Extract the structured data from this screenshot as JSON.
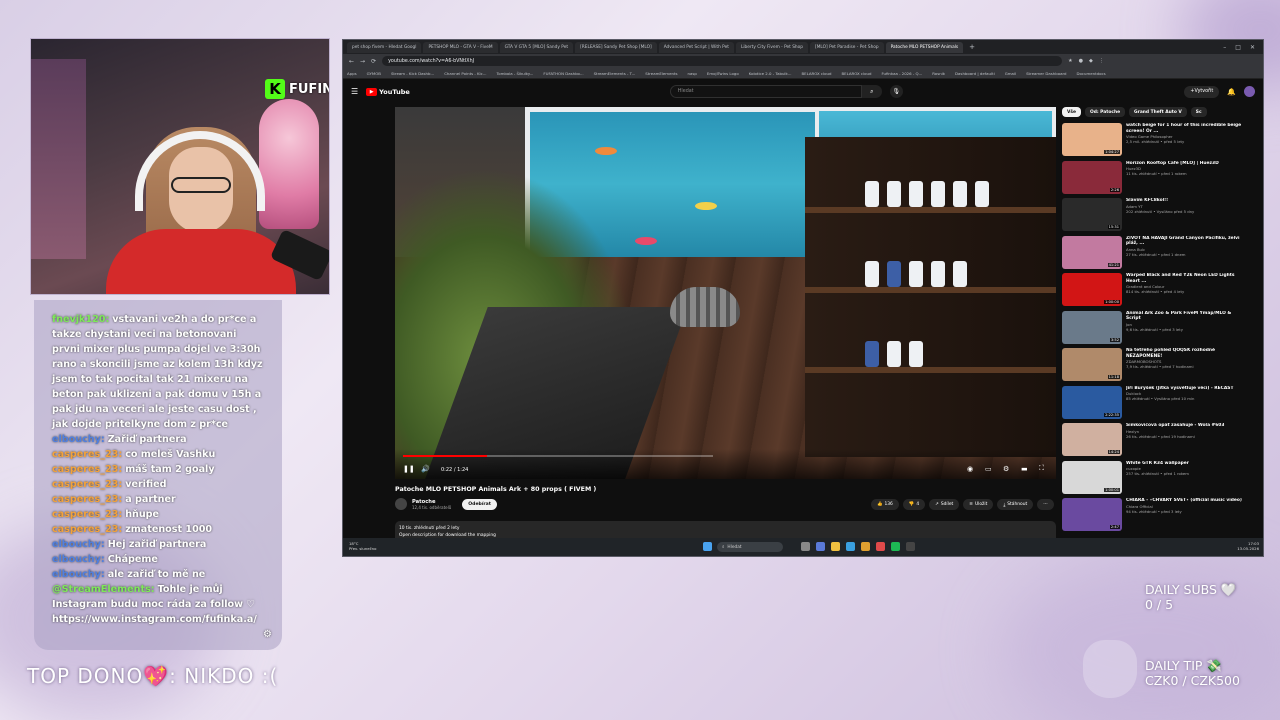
{
  "stream": {
    "brand": "FUFINKAA",
    "top_dono": "TOP DONO",
    "top_dono_value": ": NIKDO :(",
    "daily_subs_label": "DAILY SUBS",
    "daily_subs_value": "0 / 5",
    "daily_tip_label": "DAILY TIP",
    "daily_tip_value": "CZK0 / CZK500"
  },
  "chat": [
    {
      "user": "fnevjk120:",
      "user_color": "#7ee85a",
      "text": "vstavani ve2h a do pr*ce a takze chystani veci na betonovani prvni mixer plus pumpa dojel ve 3:30h rano a skoncili jsme az kolem 13h kdyz jsem to tak pocital tak 21 mixeru na beton pak uklizeni a pak domu v 15h a pak jdu na veceri ale jeste casu dost , jak dojde pritelkyne dom z pr*ce"
    },
    {
      "user": "elbouchy:",
      "user_color": "#4f7fe0",
      "text": "Zařiď partnera"
    },
    {
      "user": "casperes_23:",
      "user_color": "#f4a23a",
      "text": "co meleš Vashku"
    },
    {
      "user": "casperes_23:",
      "user_color": "#f4a23a",
      "text": "máš tam 2 goaly"
    },
    {
      "user": "casperes_23:",
      "user_color": "#f4a23a",
      "text": "verified"
    },
    {
      "user": "casperes_23:",
      "user_color": "#f4a23a",
      "text": "a partner"
    },
    {
      "user": "casperes_23:",
      "user_color": "#f4a23a",
      "text": "hňupe"
    },
    {
      "user": "casperes_23:",
      "user_color": "#f4a23a",
      "text": "zmatenost 1000"
    },
    {
      "user": "elbouchy:",
      "user_color": "#4f7fe0",
      "text": "Hej zařiď partnera"
    },
    {
      "user": "elbouchy:",
      "user_color": "#4f7fe0",
      "text": "Chápeme"
    },
    {
      "user": "elbouchy:",
      "user_color": "#4f7fe0",
      "text": "ale zařiď to mě ne"
    },
    {
      "user": "@StreamElements:",
      "user_color": "#7ee85a",
      "text": "Tohle je můj Instagram budu moc ráda za follow ♡ https://www.instagram.com/fufinka.a/"
    }
  ],
  "browser": {
    "tabs": [
      "pet shop fivem - Hledat Googl",
      "PETSHOP MLO - GTA V - FiveM",
      "GTA V GTA 5 [MLO] Sandy Pet",
      "[RELEASE] Sandy Pet Shop [MLO]",
      "Advanced Pet Script | With Pet",
      "Liberty City Fivem - Pet Shop",
      "[MLO] Pet Paradise - Pet Shop",
      "Patoche MLO PETSHOP Animals"
    ],
    "url": "youtube.com/watch?v=A6-bVNtIXhJ",
    "bookmarks": [
      "Apps",
      "GYMOB",
      "Stream - Kick Dashb...",
      "Channel Points - Kic...",
      "Tombola - Šikulky...",
      "FUFATHON Dashbo...",
      "StreamElements - T...",
      "StreamElements",
      "nasp",
      "EmojiTwins Logo",
      "Kolotice 2.0 - Tabulk...",
      "BELAROX cloud",
      "BELAROX cloud",
      "Fufinkaa - 2026 - Q...",
      "Rosnik",
      "Dashboard | defaulti",
      "Gmail",
      "Streamer Dashboard",
      "Documentdocs"
    ]
  },
  "youtube": {
    "logo": "YouTube",
    "search_placeholder": "Hledat",
    "create_label": "Vytvořit",
    "video_title": "Patoche MLO PETSHOP Animals Ark + 80 props ( FIVEM )",
    "time": "0:22 / 1:24",
    "progress": 0.27,
    "channel": "Patoche",
    "subs": "12,4 tis. odběratelů",
    "subscribe": "Odebírat",
    "likes": "136",
    "dislike_count": "4",
    "share": "Sdílet",
    "save": "Uložit",
    "download": "Stáhnout",
    "desc_line1": "10 tis. zhlédnutí  před 2 lety",
    "desc_line2": "Open description for download the mapping",
    "chips": [
      "Vše",
      "Od: Patoche",
      "Grand Theft Auto V",
      "Sc"
    ],
    "recs": [
      {
        "title": "watch beige for 1 hour of this incredible beige screen! Or ...",
        "channel": "Video Game Philosopher",
        "views": "2,5 mil. zhlédnutí • před 5 lety",
        "dur": "1:04:27",
        "color": "#e8b28a"
      },
      {
        "title": "Horizon Rooftop Cafe [MLO] | Huez3D",
        "channel": "Huez3D",
        "views": "11 tis. zhlédnutí • před 1 rokem",
        "dur": "2:26",
        "color": "#8a2a3a"
      },
      {
        "title": "Slavím KFC8kol!!",
        "channel": "Adam YT",
        "views": "202 zhlédnutí • Vysíláno před 5 dny",
        "dur": "15:31",
        "color": "#2a2a2a"
      },
      {
        "title": "ŽIVOT NA HAVAJI Grand Canyon Pacifiku, želví pláž, ...",
        "channel": "Anna Bulc",
        "views": "27 tis. zhlédnutí • před 1 dnem",
        "dur": "41:21",
        "color": "#c27aa0"
      },
      {
        "title": "Warped Black and Red Y2k Neon LED Lights Heart ...",
        "channel": "Gradient and Colour",
        "views": "814 tis. zhlédnutí • před 4 lety",
        "dur": "1:00:00",
        "color": "#d21515"
      },
      {
        "title": "Animal Ark Zoo & Park FiveM Ymap/MLO & Script",
        "channel": "Jon",
        "views": "9,6 tis. zhlédnutí • před 3 lety",
        "dur": "3:52",
        "color": "#6a7a8a"
      },
      {
        "title": "Na tetřeho pohled QOQSK rozhodně NEZAPOMENE!",
        "channel": "ZDARMOBOSHOTS",
        "views": "7,9 tis. zhlédnutí • před 7 hodinami",
        "dur": "11:18",
        "color": "#b08a6a"
      },
      {
        "title": "Jiří Burýšek (Jitka vysvětluje věci) - RECAST",
        "channel": "Duklock",
        "views": "85 zhlédnutí • Vysíláno před 10 min",
        "dur": "2:22:35",
        "color": "#2a5aa0"
      },
      {
        "title": "Šimkovičová opäť zasahuje - Wola #603",
        "channel": "Hexlyn",
        "views": "26 tis. zhlédnutí • před 19 hodinami",
        "dur": "14:24",
        "color": "#d0b0a0"
      },
      {
        "title": "White GTR R34 wallpaper",
        "channel": "cuxxpie",
        "views": "257 tis. zhlédnutí • před 1 rokem",
        "dur": "1:00:01",
        "color": "#d8d8d8"
      },
      {
        "title": "CHIARA - ⋆CHVARY SVĚT⋆ (official music video)",
        "channel": "Chiara Official",
        "views": "94 tis. zhlédnutí • před 3 lety",
        "dur": "2:47",
        "color": "#6a4aa0"
      }
    ]
  },
  "taskbar": {
    "temp": "18°C",
    "weather": "Přev. slunečno",
    "search": "Hledat",
    "time": "17:03",
    "date": "13.05.2026"
  }
}
